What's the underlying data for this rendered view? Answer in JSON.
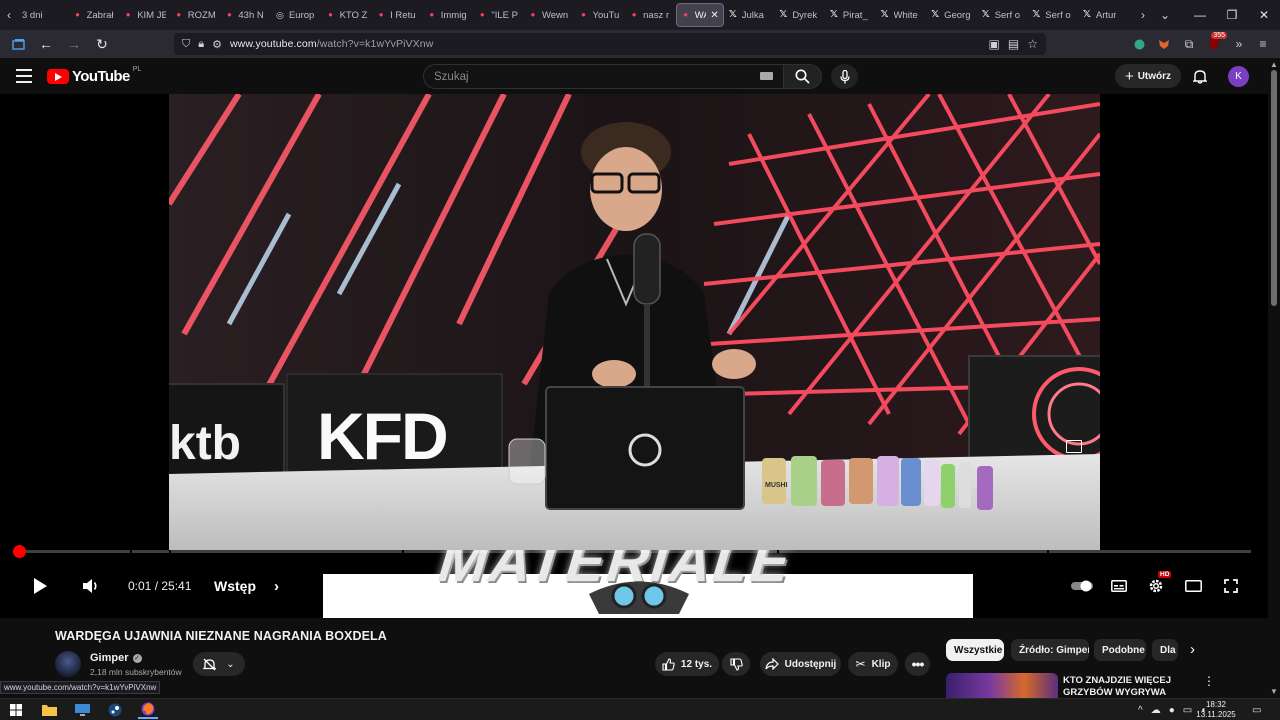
{
  "browser": {
    "tabs": [
      {
        "title": "3 dni",
        "icon": "page-icon"
      },
      {
        "title": "Zabrał",
        "icon": "youtube-icon"
      },
      {
        "title": "KIM JE",
        "icon": "youtube-icon"
      },
      {
        "title": "ROZM",
        "icon": "youtube-icon"
      },
      {
        "title": "43h N",
        "icon": "youtube-icon"
      },
      {
        "title": "Europ",
        "icon": "globe-icon"
      },
      {
        "title": "KTO Z",
        "icon": "youtube-icon"
      },
      {
        "title": "I Retu",
        "icon": "youtube-icon"
      },
      {
        "title": "Immig",
        "icon": "youtube-icon"
      },
      {
        "title": "\"ILE P",
        "icon": "youtube-icon"
      },
      {
        "title": "Wewn",
        "icon": "youtube-icon"
      },
      {
        "title": "YouTu",
        "icon": "youtube-icon"
      },
      {
        "title": "nasz r",
        "icon": "youtube-icon"
      },
      {
        "title": "WA",
        "icon": "youtube-icon",
        "active": true
      },
      {
        "title": "Julka",
        "icon": "x-icon"
      },
      {
        "title": "Dyrek",
        "icon": "x-icon"
      },
      {
        "title": "Pirat_",
        "icon": "x-icon"
      },
      {
        "title": "White",
        "icon": "x-icon"
      },
      {
        "title": "Georg",
        "icon": "x-icon"
      },
      {
        "title": "Serf o",
        "icon": "x-icon"
      },
      {
        "title": "Serf o",
        "icon": "x-icon"
      },
      {
        "title": "Artur",
        "icon": "x-icon"
      }
    ],
    "url_host": "www.youtube.com",
    "url_path": "/watch?v=k1wYvPiVXnw",
    "extension_badge": "355",
    "status_url": "www.youtube.com/watch?v=k1wYvPiVXnw"
  },
  "youtube": {
    "logo_text": "YouTube",
    "region": "PL",
    "search_placeholder": "Szukaj",
    "create_label": "Utwórz",
    "avatar_letter": "K"
  },
  "player": {
    "time_current": "0:01",
    "time_separator": " / ",
    "time_total": "25:41",
    "chapter": "Wstęp",
    "progress_fraction": 0.0007,
    "quality_badge": "HD",
    "scene_text": {
      "ktb": "ktb",
      "kfd": "KFD",
      "materiale": "MATERIALE",
      "jar_label": "MUSHI"
    }
  },
  "video": {
    "title": "WARDĘGA UJAWNIA NIEZNANE NAGRANIA BOXDELA",
    "channel": "Gimper",
    "subscribers": "2,18 mln subskrybentów",
    "likes": "12 tys.",
    "share_label": "Udostępnij",
    "clip_label": "Klip"
  },
  "sidebar": {
    "chips": [
      "Wszystkie",
      "Źródło: Gimper",
      "Podobne",
      "Dla"
    ],
    "recommendation_title": "KTO ZNAJDZIE WIĘCEJ GRZYBÓW WYGRYWA *AFERA*"
  },
  "taskbar": {
    "time": "18:32",
    "date": "13.11.2025"
  },
  "colors": {
    "accent_red": "#ff0000",
    "background": "#0f0f0f",
    "firefox_toolbar": "#2b2a33"
  }
}
